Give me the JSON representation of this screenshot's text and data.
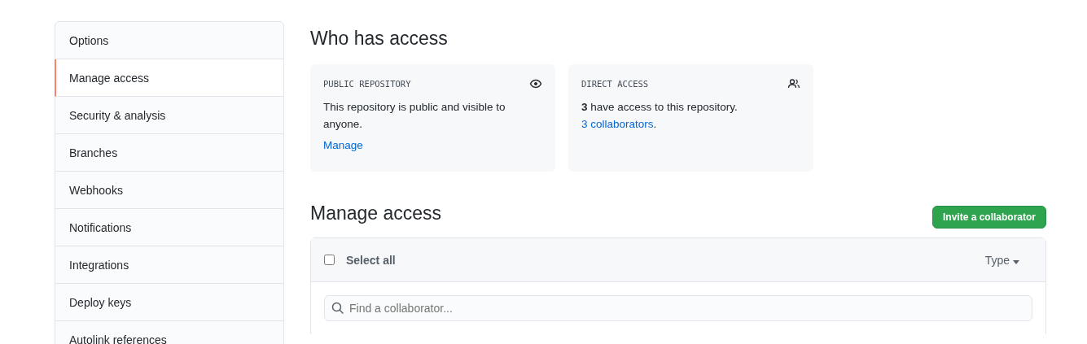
{
  "sidebar": {
    "items": [
      {
        "label": "Options",
        "selected": false
      },
      {
        "label": "Manage access",
        "selected": true
      },
      {
        "label": "Security & analysis",
        "selected": false
      },
      {
        "label": "Branches",
        "selected": false
      },
      {
        "label": "Webhooks",
        "selected": false
      },
      {
        "label": "Notifications",
        "selected": false
      },
      {
        "label": "Integrations",
        "selected": false
      },
      {
        "label": "Deploy keys",
        "selected": false
      },
      {
        "label": "Autolink references",
        "selected": false
      }
    ]
  },
  "who_has_access": {
    "title": "Who has access",
    "cards": [
      {
        "kind": "public",
        "heading": "PUBLIC REPOSITORY",
        "text": "This repository is public and visible to anyone.",
        "link": "Manage"
      },
      {
        "kind": "direct",
        "heading": "DIRECT ACCESS",
        "text": "**3** have access to this repository.",
        "link": "3 collaborators",
        "after": "."
      }
    ]
  },
  "manage_access": {
    "title": "Manage access",
    "invite_button": "Invite a collaborator",
    "select_all": {
      "label": "Select all",
      "checked": false
    },
    "type_filter": "Type",
    "search": {
      "placeholder": "Find a collaborator..."
    }
  }
}
